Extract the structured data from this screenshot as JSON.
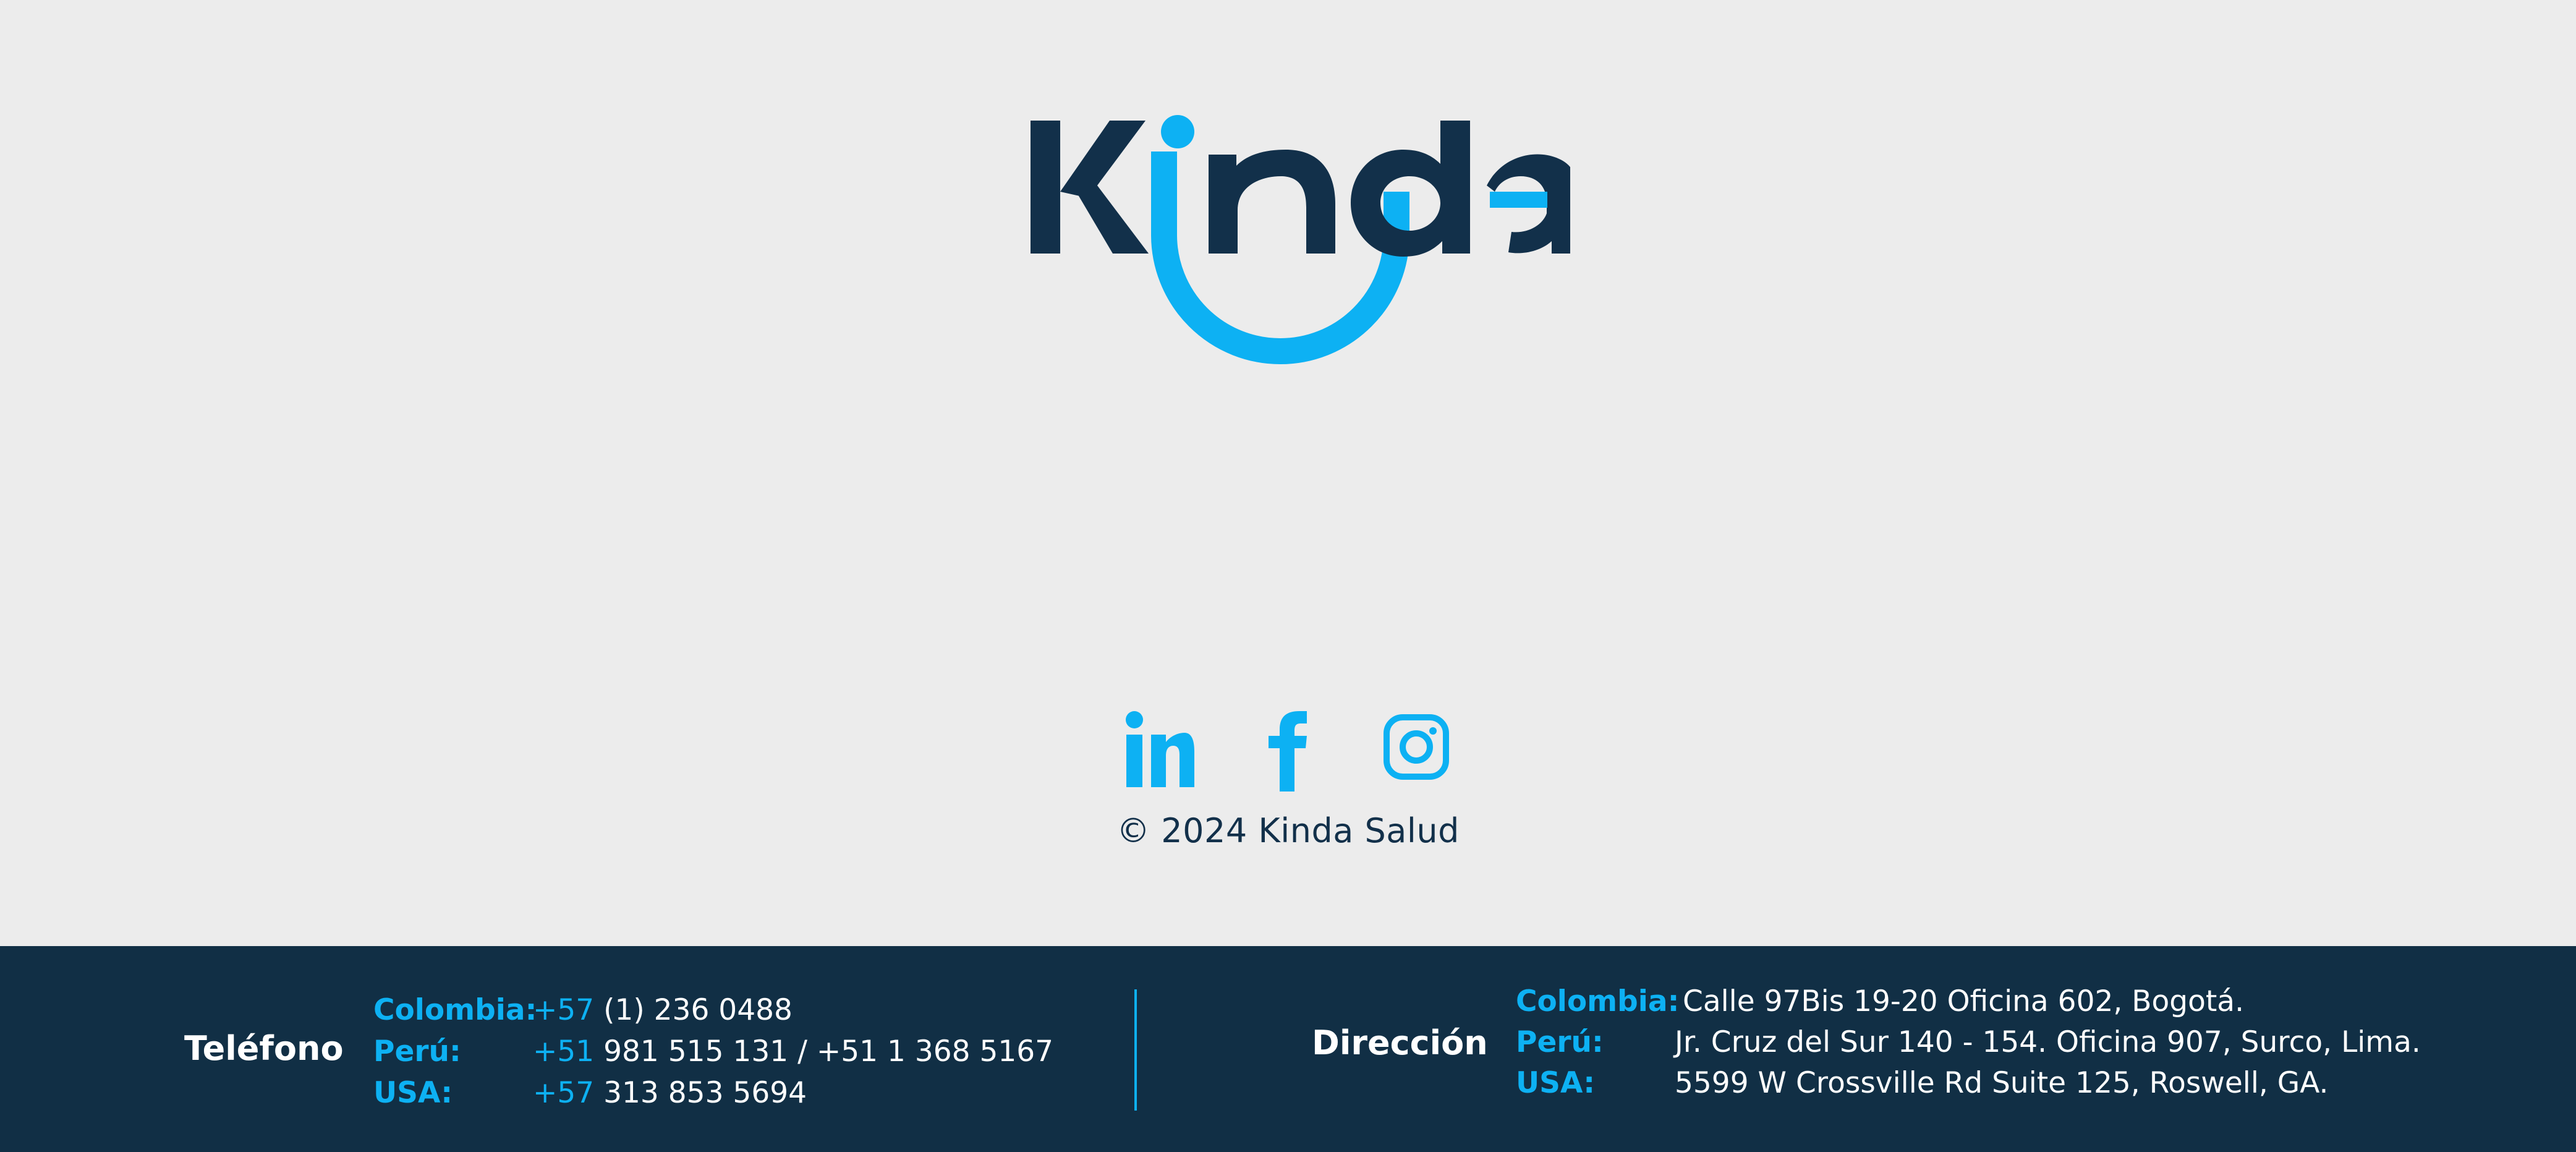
{
  "brand": {
    "logo_text": "Kinda",
    "colors": {
      "navy": "#112f45",
      "accent": "#0db1f3",
      "background": "#ececec"
    }
  },
  "social": [
    {
      "name": "LinkedIn",
      "icon": "linkedin-icon"
    },
    {
      "name": "Facebook",
      "icon": "facebook-icon"
    },
    {
      "name": "Instagram",
      "icon": "instagram-icon"
    }
  ],
  "copyright": "© 2024 Kinda Salud",
  "footer": {
    "phone": {
      "heading": "Teléfono",
      "rows": [
        {
          "label": "Colombia:",
          "prefix": "+57",
          "number": " (1) 236 0488"
        },
        {
          "label": "Perú:",
          "prefix": "+51",
          "number": " 981 515 131 / +51 1 368 5167"
        },
        {
          "label": "USA:",
          "prefix": "+57",
          "number": " 313 853 5694"
        }
      ]
    },
    "address": {
      "heading": "Dirección",
      "rows": [
        {
          "label": "Colombia:",
          "value": "Calle 97Bis 19-20 Oficina 602, Bogotá."
        },
        {
          "label": "Perú:",
          "value": "Jr. Cruz del Sur 140 - 154. Oficina 907, Surco, Lima."
        },
        {
          "label": "USA:",
          "value": "5599 W Crossville Rd Suite 125, Roswell, GA."
        }
      ]
    }
  }
}
